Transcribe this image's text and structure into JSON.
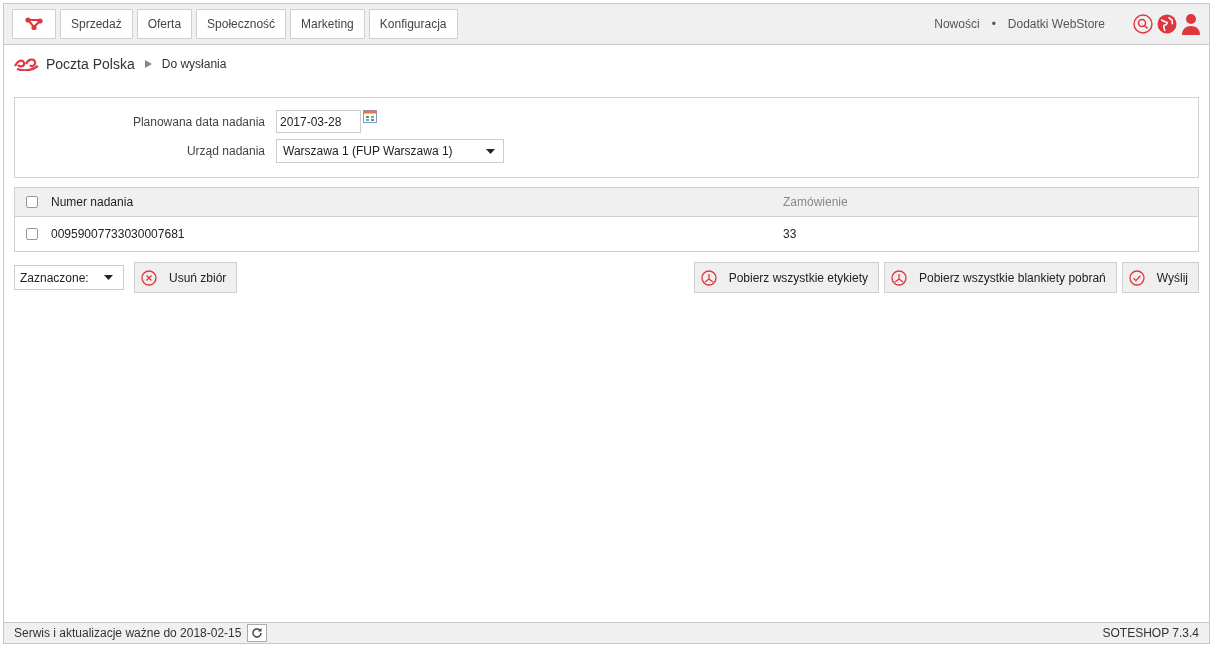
{
  "top_nav": {
    "items": [
      {
        "label": "Sprzedaż",
        "selected": false
      },
      {
        "label": "Oferta",
        "selected": false
      },
      {
        "label": "Społeczność",
        "selected": false
      },
      {
        "label": "Marketing",
        "selected": false
      },
      {
        "label": "Konfiguracja",
        "selected": false
      }
    ],
    "links": [
      "Nowości",
      "Dodatki WebStore"
    ],
    "separator": "•"
  },
  "breadcrumb": [
    "Poczta Polska",
    "Do wysłania"
  ],
  "form": {
    "date_label": "Planowana data nadania",
    "date_value": "2017-03-28",
    "office_label": "Urząd nadania",
    "office_value": "Warszawa 1 (FUP Warszawa 1)"
  },
  "table": {
    "select_all": false,
    "columns": [
      "Numer nadania",
      "Zamówienie"
    ],
    "rows": [
      {
        "checked": false,
        "cells": [
          "00959007733030007681",
          "33"
        ]
      }
    ]
  },
  "actions": {
    "batch_select": "Zaznaczone:",
    "left": [
      {
        "label": "Usuń zbiór",
        "kind": "cancel"
      }
    ],
    "right": [
      {
        "label": "Pobierz wszystkie etykiety",
        "kind": "pdf"
      },
      {
        "label": "Pobierz wszystkie blankiety pobrań",
        "kind": "pdf"
      },
      {
        "label": "Wyślij",
        "kind": "check"
      }
    ]
  },
  "status_bar": {
    "service": "Serwis i aktualizacje ważne do 2018-02-15",
    "version": "SOTESHOP 7.3.4"
  }
}
